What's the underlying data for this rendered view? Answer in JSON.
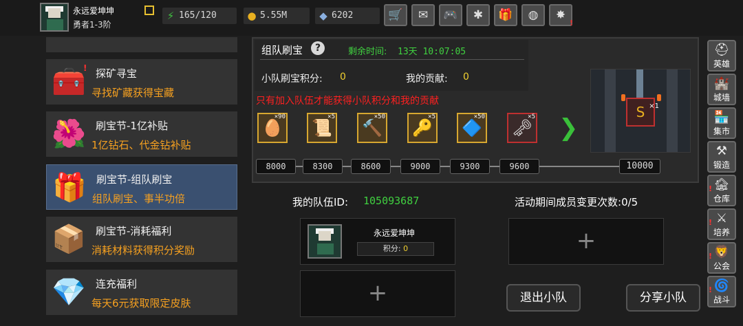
{
  "player": {
    "name": "永远爱坤坤",
    "rank": "勇者1-3阶"
  },
  "resources": [
    {
      "icon": "energy-icon",
      "glyph": "⚡",
      "value": "165/120",
      "color": "#40c040"
    },
    {
      "icon": "gold-coin-icon",
      "glyph": "●",
      "value": "5.55M",
      "color": "#e8b020"
    },
    {
      "icon": "gem-icon",
      "glyph": "◆",
      "value": "6202",
      "color": "#8ab0e0"
    }
  ],
  "top_buttons": [
    {
      "name": "shop-icon",
      "glyph": "🛒",
      "badge": ""
    },
    {
      "name": "mail-icon",
      "glyph": "✉",
      "badge": ""
    },
    {
      "name": "gamepad-icon",
      "glyph": "🎮",
      "badge": ""
    },
    {
      "name": "settings-icon",
      "glyph": "✱",
      "badge": ""
    },
    {
      "name": "gift-icon",
      "glyph": "🎁",
      "badge": ""
    },
    {
      "name": "color-wheel-icon",
      "glyph": "◍",
      "badge": ""
    },
    {
      "name": "fireworks-icon",
      "glyph": "✸",
      "badge": "!"
    }
  ],
  "events": [
    {
      "name": "event-mining",
      "title": "探矿寻宝",
      "subtitle": "寻找矿藏获得宝藏",
      "icon": "treasure-chest-icon",
      "glyph": "🧰",
      "badge": "!"
    },
    {
      "name": "event-subsidy",
      "title": "刷宝节-1亿补贴",
      "subtitle": "1亿钻石、代金钻补贴",
      "icon": "red-flower-icon",
      "glyph": "🌺",
      "badge": ""
    },
    {
      "name": "event-team",
      "title": "刷宝节-组队刷宝",
      "subtitle": "组队刷宝、事半功倍",
      "icon": "red-chest-icon",
      "glyph": "🎁",
      "badge": ""
    },
    {
      "name": "event-consume",
      "title": "刷宝节-消耗福利",
      "subtitle": "消耗材料获得积分奖励",
      "icon": "open-chest-icon",
      "glyph": "📦",
      "badge": ""
    },
    {
      "name": "event-recharge",
      "title": "连充福利",
      "subtitle": "每天6元获取限定皮肤",
      "icon": "crystal-icon",
      "glyph": "💎",
      "badge": ""
    }
  ],
  "panel": {
    "title": "组队刷宝",
    "time_label": "剩余时间:",
    "time_value": "13天 10:07:05",
    "team_score_label": "小队刷宝积分:",
    "team_score_value": "0",
    "my_contribution_label": "我的贡献:",
    "my_contribution_value": "0",
    "warning": "只有加入队伍才能获得小队积分和我的贡献"
  },
  "rewards": [
    {
      "icon": "golden-egg-icon",
      "glyph": "🥚",
      "qty": "×90",
      "frame": "gold"
    },
    {
      "icon": "scroll-icon",
      "glyph": "📜",
      "qty": "×5",
      "frame": "gold"
    },
    {
      "icon": "hammer-icon",
      "glyph": "🔨",
      "qty": "×50",
      "frame": "gold"
    },
    {
      "icon": "key-icon",
      "glyph": "🔑",
      "qty": "×5",
      "frame": "gold"
    },
    {
      "icon": "blue-ore-icon",
      "glyph": "🔷",
      "qty": "×50",
      "frame": "gold"
    },
    {
      "icon": "keys-icon",
      "glyph": "🗝",
      "qty": "×5",
      "frame": "red"
    }
  ],
  "thresholds": [
    "8000",
    "8300",
    "8600",
    "9000",
    "9300",
    "9600",
    "10000"
  ],
  "prize": {
    "icon": "figure-prize-icon",
    "glyph": "S",
    "qty": "×1"
  },
  "team": {
    "id_label": "我的队伍ID:",
    "id_value": "105093687",
    "changes_label": "活动期间成员变更次数:",
    "changes_value": "0/5",
    "member_name": "永远爱坤坤",
    "member_score_label": "积分:",
    "member_score_value": "0",
    "empty_glyph": "+"
  },
  "buttons": {
    "leave": "退出小队",
    "share": "分享小队"
  },
  "sidebar": [
    {
      "name": "sidebar-hero",
      "icon": "helmet-icon",
      "glyph": "⛑",
      "label": "英雄",
      "badge": ""
    },
    {
      "name": "sidebar-wall",
      "icon": "wall-icon",
      "glyph": "🏰",
      "label": "城墙",
      "badge": ""
    },
    {
      "name": "sidebar-market",
      "icon": "market-icon",
      "glyph": "🏪",
      "label": "集市",
      "badge": ""
    },
    {
      "name": "sidebar-forge",
      "icon": "anvil-icon",
      "glyph": "⚒",
      "label": "锻造",
      "badge": ""
    },
    {
      "name": "sidebar-warehouse",
      "icon": "warehouse-icon",
      "glyph": "🏚",
      "label": "仓库",
      "badge": "!"
    },
    {
      "name": "sidebar-train",
      "icon": "train-icon",
      "glyph": "⚔",
      "label": "培养",
      "badge": "!"
    },
    {
      "name": "sidebar-guild",
      "icon": "guild-icon",
      "glyph": "🦁",
      "label": "公会",
      "badge": "!"
    },
    {
      "name": "sidebar-battle",
      "icon": "portal-icon",
      "glyph": "🌀",
      "label": "战斗",
      "badge": "!"
    }
  ]
}
